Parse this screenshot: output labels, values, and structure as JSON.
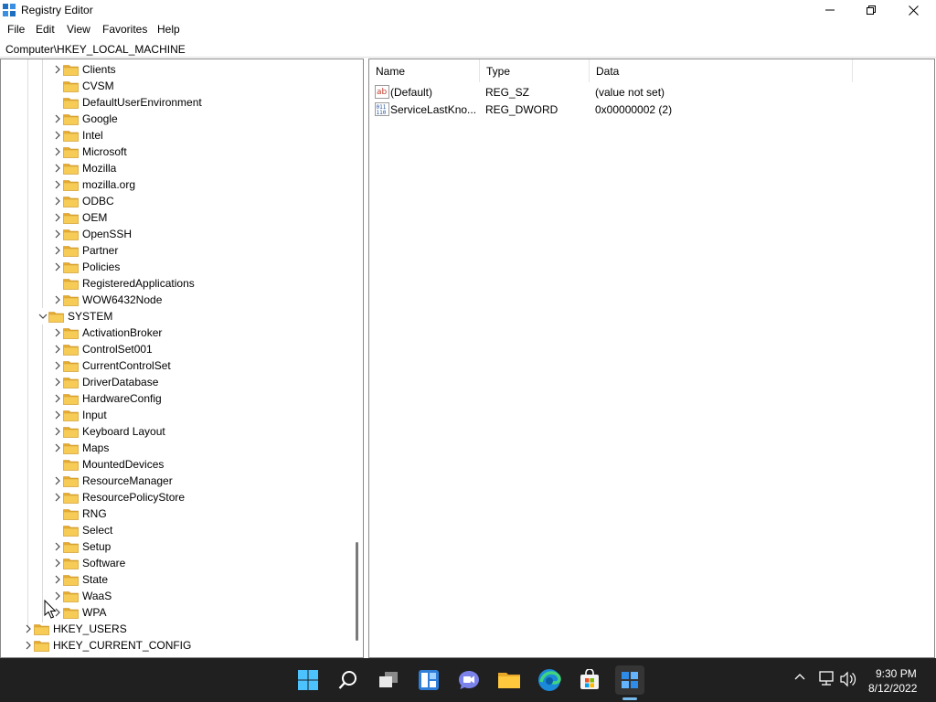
{
  "window": {
    "title": "Registry Editor"
  },
  "menu": [
    "File",
    "Edit",
    "View",
    "Favorites",
    "Help"
  ],
  "address": "Computer\\HKEY_LOCAL_MACHINE",
  "tree": {
    "software_children": [
      {
        "label": "Clients",
        "expandable": true
      },
      {
        "label": "CVSM",
        "expandable": false
      },
      {
        "label": "DefaultUserEnvironment",
        "expandable": false
      },
      {
        "label": "Google",
        "expandable": true
      },
      {
        "label": "Intel",
        "expandable": true
      },
      {
        "label": "Microsoft",
        "expandable": true
      },
      {
        "label": "Mozilla",
        "expandable": true
      },
      {
        "label": "mozilla.org",
        "expandable": true
      },
      {
        "label": "ODBC",
        "expandable": true
      },
      {
        "label": "OEM",
        "expandable": true
      },
      {
        "label": "OpenSSH",
        "expandable": true
      },
      {
        "label": "Partner",
        "expandable": true
      },
      {
        "label": "Policies",
        "expandable": true
      },
      {
        "label": "RegisteredApplications",
        "expandable": false
      },
      {
        "label": "WOW6432Node",
        "expandable": true
      }
    ],
    "system": {
      "label": "SYSTEM",
      "expanded": true
    },
    "system_children": [
      {
        "label": "ActivationBroker",
        "expandable": true
      },
      {
        "label": "ControlSet001",
        "expandable": true
      },
      {
        "label": "CurrentControlSet",
        "expandable": true
      },
      {
        "label": "DriverDatabase",
        "expandable": true
      },
      {
        "label": "HardwareConfig",
        "expandable": true
      },
      {
        "label": "Input",
        "expandable": true
      },
      {
        "label": "Keyboard Layout",
        "expandable": true
      },
      {
        "label": "Maps",
        "expandable": true
      },
      {
        "label": "MountedDevices",
        "expandable": false
      },
      {
        "label": "ResourceManager",
        "expandable": true
      },
      {
        "label": "ResourcePolicyStore",
        "expandable": true
      },
      {
        "label": "RNG",
        "expandable": false
      },
      {
        "label": "Select",
        "expandable": false
      },
      {
        "label": "Setup",
        "expandable": true
      },
      {
        "label": "Software",
        "expandable": true
      },
      {
        "label": "State",
        "expandable": true
      },
      {
        "label": "WaaS",
        "expandable": true
      },
      {
        "label": "WPA",
        "expandable": true
      }
    ],
    "roots": [
      {
        "label": "HKEY_USERS",
        "expandable": true
      },
      {
        "label": "HKEY_CURRENT_CONFIG",
        "expandable": true
      }
    ]
  },
  "values": {
    "columns": [
      "Name",
      "Type",
      "Data"
    ],
    "rows": [
      {
        "icon": "string-value-icon",
        "name": "(Default)",
        "type": "REG_SZ",
        "data": "(value not set)"
      },
      {
        "icon": "binary-value-icon",
        "name": "ServiceLastKno...",
        "type": "REG_DWORD",
        "data": "0x00000002 (2)"
      }
    ]
  },
  "taskbar": {
    "apps": [
      "start-icon",
      "search-icon",
      "task-view-icon",
      "widgets-icon",
      "chat-icon",
      "file-explorer-icon",
      "edge-icon",
      "store-icon",
      "registry-editor-icon"
    ],
    "clock": {
      "time": "9:30 PM",
      "date": "8/12/2022"
    }
  },
  "colors": {
    "folder": "#f0c24a",
    "taskbar": "#202020",
    "accent": "#76b9ed"
  }
}
